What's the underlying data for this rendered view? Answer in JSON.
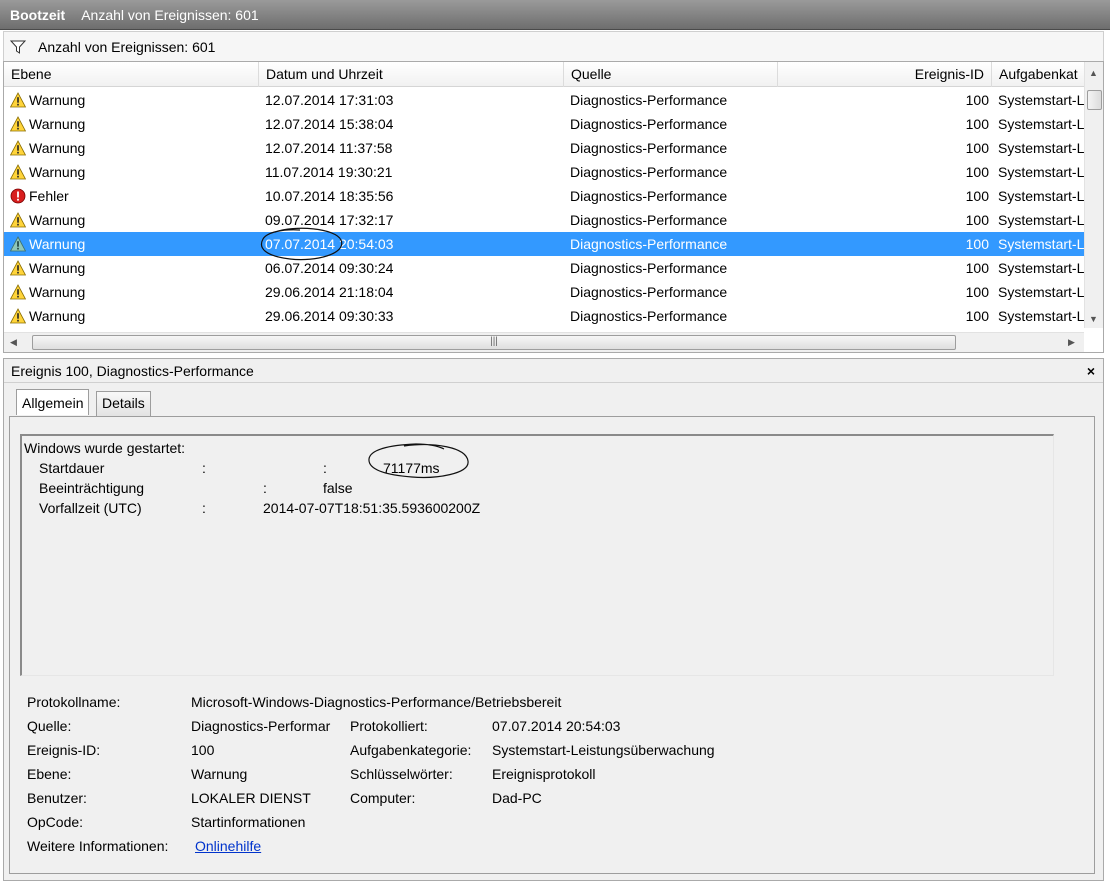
{
  "titlebar": {
    "app": "Bootzeit",
    "count": "Anzahl von Ereignissen: 601"
  },
  "filter": {
    "icon": "funnel-icon",
    "text": "Anzahl von Ereignissen: 601"
  },
  "table": {
    "columns": [
      "Ebene",
      "Datum und Uhrzeit",
      "Quelle",
      "Ereignis-ID",
      "Aufgabenkat"
    ],
    "rows": [
      {
        "icon": "warning",
        "level": "Warnung",
        "date": "12.07.2014 17:31:03",
        "source": "Diagnostics-Performance",
        "id": "100",
        "task": "Systemstart-L"
      },
      {
        "icon": "warning",
        "level": "Warnung",
        "date": "12.07.2014 15:38:04",
        "source": "Diagnostics-Performance",
        "id": "100",
        "task": "Systemstart-L"
      },
      {
        "icon": "warning",
        "level": "Warnung",
        "date": "12.07.2014 11:37:58",
        "source": "Diagnostics-Performance",
        "id": "100",
        "task": "Systemstart-L"
      },
      {
        "icon": "warning",
        "level": "Warnung",
        "date": "11.07.2014 19:30:21",
        "source": "Diagnostics-Performance",
        "id": "100",
        "task": "Systemstart-L"
      },
      {
        "icon": "error",
        "level": "Fehler",
        "date": "10.07.2014 18:35:56",
        "source": "Diagnostics-Performance",
        "id": "100",
        "task": "Systemstart-L"
      },
      {
        "icon": "warning",
        "level": "Warnung",
        "date": "09.07.2014 17:32:17",
        "source": "Diagnostics-Performance",
        "id": "100",
        "task": "Systemstart-L"
      },
      {
        "icon": "warning",
        "level": "Warnung",
        "date": "07.07.2014 20:54:03",
        "source": "Diagnostics-Performance",
        "id": "100",
        "task": "Systemstart-L",
        "selected": true
      },
      {
        "icon": "warning",
        "level": "Warnung",
        "date": "06.07.2014 09:30:24",
        "source": "Diagnostics-Performance",
        "id": "100",
        "task": "Systemstart-L"
      },
      {
        "icon": "warning",
        "level": "Warnung",
        "date": "29.06.2014 21:18:04",
        "source": "Diagnostics-Performance",
        "id": "100",
        "task": "Systemstart-L"
      },
      {
        "icon": "warning",
        "level": "Warnung",
        "date": "29.06.2014 09:30:33",
        "source": "Diagnostics-Performance",
        "id": "100",
        "task": "Systemstart-L"
      }
    ]
  },
  "detail": {
    "title": "Ereignis 100, Diagnostics-Performance",
    "close": "×",
    "tabs": [
      "Allgemein",
      "Details"
    ],
    "message": {
      "heading": "Windows wurde gestartet:",
      "startdauer_label": "Startdauer",
      "startdauer_colon1": ":",
      "startdauer_colon2": ":",
      "startdauer_value": "71177ms",
      "beeintr_label": "Beeinträchtigung",
      "beeintr_colon": ":",
      "beeintr_value": "false",
      "vorfall_label": "Vorfallzeit (UTC)",
      "vorfall_colon": ":",
      "vorfall_value": "2014-07-07T18:51:35.593600200Z"
    },
    "props": {
      "protokollname_label": "Protokollname:",
      "protokollname_value": "Microsoft-Windows-Diagnostics-Performance/Betriebsbereit",
      "quelle_label": "Quelle:",
      "quelle_value": "Diagnostics-Performar",
      "protokolliert_label": "Protokolliert:",
      "protokolliert_value": "07.07.2014 20:54:03",
      "ereignisid_label": "Ereignis-ID:",
      "ereignisid_value": "100",
      "aufgabe_label": "Aufgabenkategorie:",
      "aufgabe_value": "Systemstart-Leistungsüberwachung",
      "ebene_label": "Ebene:",
      "ebene_value": "Warnung",
      "schluessel_label": "Schlüsselwörter:",
      "schluessel_value": "Ereignisprotokoll",
      "benutzer_label": "Benutzer:",
      "benutzer_value": "LOKALER DIENST",
      "computer_label": "Computer:",
      "computer_value": "Dad-PC",
      "opcode_label": "OpCode:",
      "opcode_value": "Startinformationen",
      "weitere_label": "Weitere Informationen:",
      "weitere_link": "Onlinehilfe"
    }
  },
  "colors": {
    "selection": "#3399ff",
    "link": "#0033cc",
    "titlebar": "#7a7a7a"
  }
}
